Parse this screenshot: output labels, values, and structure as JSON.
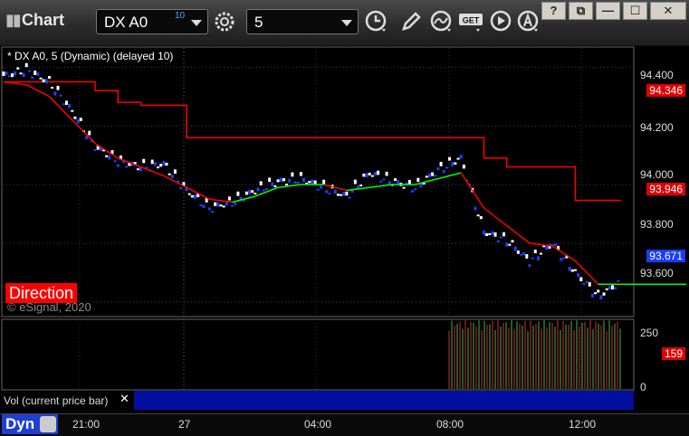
{
  "toolbar": {
    "app_title": "Chart",
    "symbol": "DX A0",
    "symbol_sup": "10",
    "interval": "5",
    "get_label": "GET"
  },
  "window": {
    "help": "?",
    "restore": "⧉",
    "minimize": "—",
    "maximize": "☐",
    "close": "✕"
  },
  "chart": {
    "label": "* DX A0, 5 (Dynamic) (delayed 10)",
    "watermark": "© eSignal, 2020",
    "direction_label": "Direction",
    "price_axis": [
      "94.400",
      "94.200",
      "94.000",
      "93.800",
      "93.600"
    ],
    "last_price": "93.671",
    "red_upper": "94.346",
    "red_lower": "93.946",
    "colors": {
      "red_line": "#ff0000",
      "green_line": "#00ff00",
      "up_bar": "#ffffff",
      "down_bar": "#1f3fff"
    }
  },
  "volume": {
    "label": "Vol (current price bar)",
    "close": "✕",
    "axis": [
      "250",
      "0"
    ],
    "current": "159"
  },
  "time_axis": [
    "21:00",
    "27",
    "04:00",
    "08:00",
    "12:00"
  ],
  "status": {
    "dyn_label": "Dyn"
  },
  "chart_data": {
    "type": "line",
    "title": "* DX A0, 5 (Dynamic) (delayed 10)",
    "xlabel": "",
    "ylabel": "",
    "ylim": [
      93.55,
      94.45
    ],
    "y_ticks": [
      94.4,
      94.2,
      94.0,
      93.8,
      93.6
    ],
    "x_ticks": [
      "21:00",
      "27",
      "04:00",
      "08:00",
      "12:00"
    ],
    "x": [
      0,
      10,
      20,
      30,
      40,
      50,
      60,
      70,
      80,
      90,
      100,
      110,
      120,
      130,
      140,
      150,
      160,
      170,
      180,
      190,
      200,
      210,
      220,
      230,
      240,
      250,
      260,
      270
    ],
    "price": [
      94.37,
      94.39,
      94.35,
      94.25,
      94.13,
      94.08,
      94.06,
      94.07,
      93.98,
      93.92,
      93.94,
      93.98,
      94.01,
      94.02,
      93.99,
      93.96,
      94.04,
      94.01,
      93.99,
      94.05,
      94.09,
      93.84,
      93.81,
      93.74,
      93.8,
      93.7,
      93.62,
      93.67
    ],
    "series": [
      {
        "name": "",
        "values": [
          94.35,
          94.35,
          94.35,
          94.35,
          94.32,
          94.28,
          94.27,
          94.27,
          94.16,
          94.16,
          94.16,
          94.16,
          94.16,
          94.16,
          94.16,
          94.16,
          94.16,
          94.16,
          94.16,
          94.16,
          94.16,
          94.09,
          94.06,
          94.06,
          94.06,
          93.946,
          93.946,
          93.946
        ]
      },
      {
        "name": "",
        "values": [
          94.35,
          94.34,
          94.3,
          94.22,
          94.14,
          94.09,
          94.06,
          94.03,
          93.99,
          93.95,
          93.94,
          93.96,
          93.99,
          94.0,
          94.0,
          93.98,
          93.99,
          94.0,
          94.0,
          94.02,
          94.04,
          93.92,
          93.86,
          93.8,
          93.79,
          93.74,
          93.66,
          93.66
        ]
      }
    ],
    "volume": {
      "ylim": [
        0,
        250
      ],
      "current": 159,
      "start_time": "08:00"
    }
  }
}
